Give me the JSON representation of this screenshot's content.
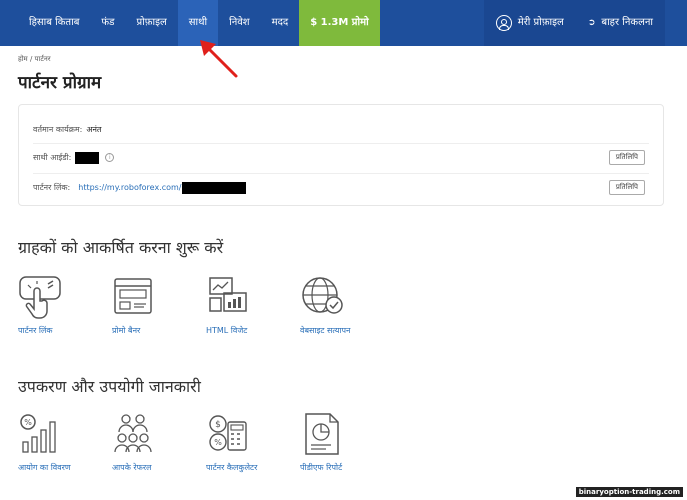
{
  "nav": {
    "items": [
      "हिसाब किताब",
      "फंड",
      "प्रोफ़ाइल",
      "साथी",
      "निवेश",
      "मदद"
    ],
    "promo": "$ 1.3M प्रोमो",
    "profile": "मेरी प्रोफ़ाइल",
    "logout": "बाहर निकलना"
  },
  "breadcrumb": "होम / पार्टनर",
  "page_title": "पार्टनर प्रोग्राम",
  "info": {
    "program_label": "वर्तमान कार्यक्रम:",
    "program_value": "अनंत",
    "partner_id_label": "साथी आईडी:",
    "partner_link_label": "पार्टनर लिंक:",
    "partner_link_value": "https://my.roboforex.com/",
    "copy_label": "प्रतिलिपि"
  },
  "section1": {
    "title": "ग्राहकों को आकर्षित करना शुरू करें",
    "tiles": [
      "पार्टनर लिंक",
      "प्रोमो बैनर",
      "HTML विजेट",
      "वेबसाइट सत्यापन"
    ]
  },
  "section2": {
    "title": "उपकरण और उपयोगी जानकारी",
    "tiles": [
      "आयोग का विवरण",
      "आपके रेफरल",
      "पार्टनर कैलकुलेटर",
      "पीडीएफ रिपोर्ट"
    ]
  },
  "watermark": "binaryoption-trading.com",
  "colors": {
    "topbar": "#1e4f9c",
    "promo": "#7fba3c",
    "link": "#2a6fb8",
    "arrow": "#e0201b"
  }
}
